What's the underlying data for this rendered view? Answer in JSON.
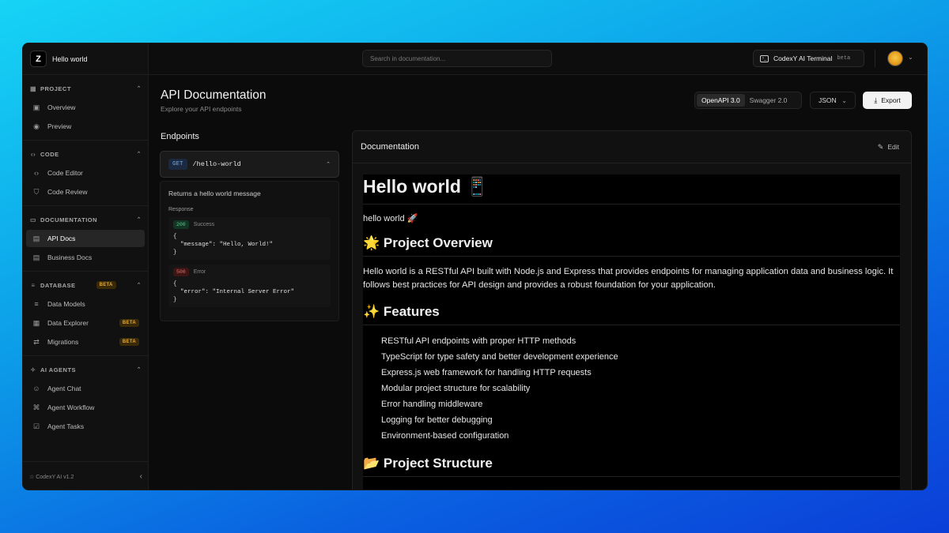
{
  "brand": {
    "logo": "Z",
    "name": "Hello world"
  },
  "sidebar": {
    "sections": [
      {
        "title": "PROJECT",
        "icon": "grid-icon",
        "items": [
          {
            "label": "Overview",
            "icon": "dashboard-icon"
          },
          {
            "label": "Preview",
            "icon": "eye-icon"
          }
        ]
      },
      {
        "title": "CODE",
        "icon": "code-icon",
        "items": [
          {
            "label": "Code Editor",
            "icon": "code-icon"
          },
          {
            "label": "Code Review",
            "icon": "shield-check-icon"
          }
        ]
      },
      {
        "title": "DOCUMENTATION",
        "icon": "book-icon",
        "items": [
          {
            "label": "API Docs",
            "icon": "file-code-icon",
            "active": true
          },
          {
            "label": "Business Docs",
            "icon": "file-text-icon"
          }
        ]
      },
      {
        "title": "DATABASE",
        "icon": "database-icon",
        "badge": "BETA",
        "items": [
          {
            "label": "Data Models",
            "icon": "database-icon"
          },
          {
            "label": "Data Explorer",
            "icon": "table-icon",
            "badge": "BETA"
          },
          {
            "label": "Migrations",
            "icon": "migration-icon",
            "badge": "BETA"
          }
        ]
      },
      {
        "title": "AI AGENTS",
        "icon": "sparkle-icon",
        "items": [
          {
            "label": "Agent Chat",
            "icon": "bot-icon"
          },
          {
            "label": "Agent Workflow",
            "icon": "workflow-icon"
          },
          {
            "label": "Agent Tasks",
            "icon": "checkbox-icon"
          }
        ]
      }
    ],
    "footer": "☆ CodexY AI v1.2"
  },
  "topbar": {
    "search_placeholder": "Search in documentation...",
    "terminal_label": "CodexY AI Terminal",
    "terminal_badge": "beta"
  },
  "page": {
    "title": "API Documentation",
    "subtitle": "Explore your API endpoints",
    "spec_options": [
      "OpenAPI 3.0",
      "Swagger 2.0"
    ],
    "spec_selected": "OpenAPI 3.0",
    "format": "JSON",
    "export_label": "Export"
  },
  "endpoints": {
    "title": "Endpoints",
    "method": "GET",
    "path": "/hello-world",
    "description": "Returns a hello world message",
    "response_label": "Response",
    "responses": [
      {
        "code": "200",
        "status": "Success",
        "body": "{\n  \"message\": \"Hello, World!\"\n}"
      },
      {
        "code": "500",
        "status": "Error",
        "body": "{\n  \"error\": \"Internal Server Error\"\n}"
      }
    ]
  },
  "documentation": {
    "title": "Documentation",
    "edit_label": "Edit",
    "h1": "Hello world 📱",
    "intro": "hello world 🚀",
    "overview_heading": "🌟 Project Overview",
    "overview_text": "Hello world is a RESTful API built with Node.js and Express that provides endpoints for managing application data and business logic. It follows best practices for API design and provides a robust foundation for your application.",
    "features_heading": "✨ Features",
    "features": [
      "RESTful API endpoints with proper HTTP methods",
      "TypeScript for type safety and better development experience",
      "Express.js web framework for handling HTTP requests",
      "Modular project structure for scalability",
      "Error handling middleware",
      "Logging for better debugging",
      "Environment-based configuration"
    ],
    "structure_heading": "📂 Project Structure"
  }
}
